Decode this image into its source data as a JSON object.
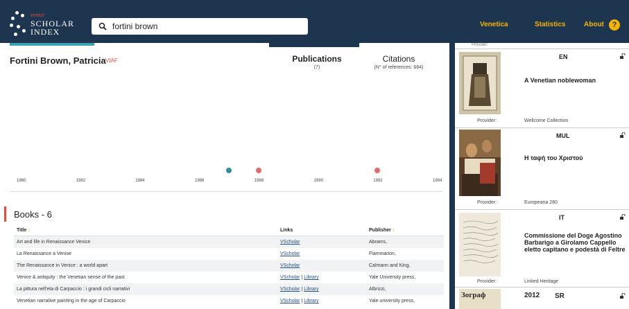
{
  "header": {
    "logo_venice": "venice",
    "logo_scholar": "SCHOLAR",
    "logo_index": "INDEX",
    "search_value": "fortini brown",
    "nav": [
      "Venetica",
      "Statistics",
      "About"
    ],
    "help_label": "?"
  },
  "author": {
    "name": "Fortini Brown, Patricia",
    "viaf": "VIAF"
  },
  "stats": {
    "publications_title": "Publications",
    "publications_count": "(7)",
    "citations_title": "Citations",
    "citations_count": "(N° of references: 664)"
  },
  "timeline": {
    "ticks": [
      "1980",
      "1982",
      "1984",
      "1986",
      "1988",
      "1990",
      "1992",
      "1994"
    ],
    "points": [
      {
        "year": 1987,
        "color": "#2f8f9d"
      },
      {
        "year": 1988,
        "color": "#e46b6b"
      },
      {
        "year": 1992,
        "color": "#e46b6b"
      }
    ]
  },
  "books": {
    "heading": "Books - 6",
    "columns": [
      "Title",
      "Links",
      "Publisher"
    ],
    "sort_glyph": "↕",
    "rows": [
      {
        "title": "Art and life in Renaissance Venice",
        "links": [
          "VScholar"
        ],
        "publisher": "Abrams,"
      },
      {
        "title": "La Renaissance a Venise",
        "links": [
          "VScholar"
        ],
        "publisher": "Flammarion,"
      },
      {
        "title": "The Renaissance in Venice : a world apart",
        "links": [
          "VScholar"
        ],
        "publisher": "Calmann and King,"
      },
      {
        "title": "Venice & antiquity : the Venetian sense of the past",
        "links": [
          "VScholar",
          "Library"
        ],
        "publisher": "Yale University press,"
      },
      {
        "title": "La pittura nell'eta di Carpaccio : i grandi cicli narrativi",
        "links": [
          "VScholar",
          "Library"
        ],
        "publisher": "Albrizzi,"
      },
      {
        "title": "Venetian narrative painting in the age of Carpaccio",
        "links": [
          "VScholar",
          "Library"
        ],
        "publisher": "Yale university press,"
      }
    ]
  },
  "side": {
    "top_provider_label": "Provider:",
    "cards": [
      {
        "lang": "EN",
        "title": "A Venetian noblewoman",
        "provider_label": "Provider:",
        "provider": "Wellcome Collection"
      },
      {
        "lang": "MUL",
        "title": "Η ταφή του Χριστού",
        "provider_label": "Provider:",
        "provider": "Europeana 280"
      },
      {
        "lang": "IT",
        "title": "Commissione del Doge Agostino Barbarigo a Girolamo Cappello eletto capitano e podestà di Feltre",
        "provider_label": "Provider:",
        "provider": "Linked Heritage"
      },
      {
        "year": "2012",
        "lang": "SR",
        "thumb_text": "Зограф"
      }
    ]
  },
  "colors": {
    "navy": "#1e3550",
    "accent_yellow": "#f4b400",
    "accent_red": "#e94c3d",
    "teal": "#3ba3b2"
  }
}
